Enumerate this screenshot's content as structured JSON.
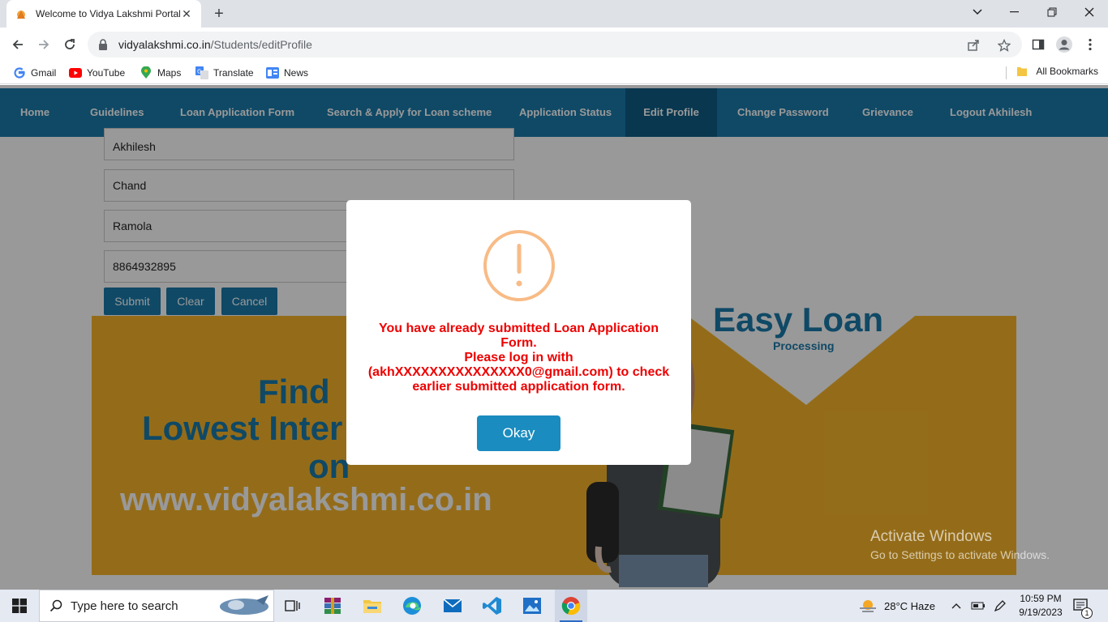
{
  "browser": {
    "tab_title": "Welcome to Vidya Lakshmi Portal",
    "url_host": "vidyalakshmi.co.in",
    "url_path": "/Students/editProfile",
    "bookmarks": [
      {
        "label": "Gmail",
        "icon": "gmail-icon"
      },
      {
        "label": "YouTube",
        "icon": "youtube-icon"
      },
      {
        "label": "Maps",
        "icon": "maps-icon"
      },
      {
        "label": "Translate",
        "icon": "translate-icon"
      },
      {
        "label": "News",
        "icon": "news-icon"
      }
    ],
    "all_bookmarks": "All Bookmarks"
  },
  "nav": {
    "items": [
      "Home",
      "Guidelines",
      "Loan Application Form",
      "Search & Apply for Loan scheme",
      "Application Status",
      "Edit Profile",
      "Change Password",
      "Grievance",
      "Logout Akhilesh"
    ],
    "active": "Edit Profile"
  },
  "form": {
    "first_name": "Akhilesh",
    "middle_name": "Chand",
    "last_name": "Ramola",
    "mobile": "8864932895",
    "submit": "Submit",
    "clear": "Clear",
    "cancel": "Cancel"
  },
  "banner": {
    "line1": "Find",
    "line2": "Lowest Inter",
    "line3": "on",
    "site": "www.vidyalakshmi.co.in",
    "easy_loan": "Easy Loan",
    "processing": "Processing"
  },
  "modal": {
    "line1": "You have already submitted Loan Application",
    "line2": "Form.",
    "line3": "Please log in with",
    "line4": "(akhXXXXXXXXXXXXXXX0@gmail.com) to check",
    "line5": "earlier submitted application form.",
    "okay": "Okay",
    "icon": "warning-icon",
    "icon_color": "#f8bb86",
    "text_color": "#ee0000"
  },
  "watermark": {
    "line1": "Activate Windows",
    "line2": "Go to Settings to activate Windows."
  },
  "taskbar": {
    "search_placeholder": "Type here to search",
    "weather": "28°C  Haze",
    "time": "10:59 PM",
    "date": "9/19/2023",
    "notifications": "1"
  },
  "colors": {
    "nav_bg": "#1a7bab",
    "nav_active": "#0e5d84",
    "banner_bg": "#f7b52b",
    "button_bg": "#1a7bab"
  }
}
